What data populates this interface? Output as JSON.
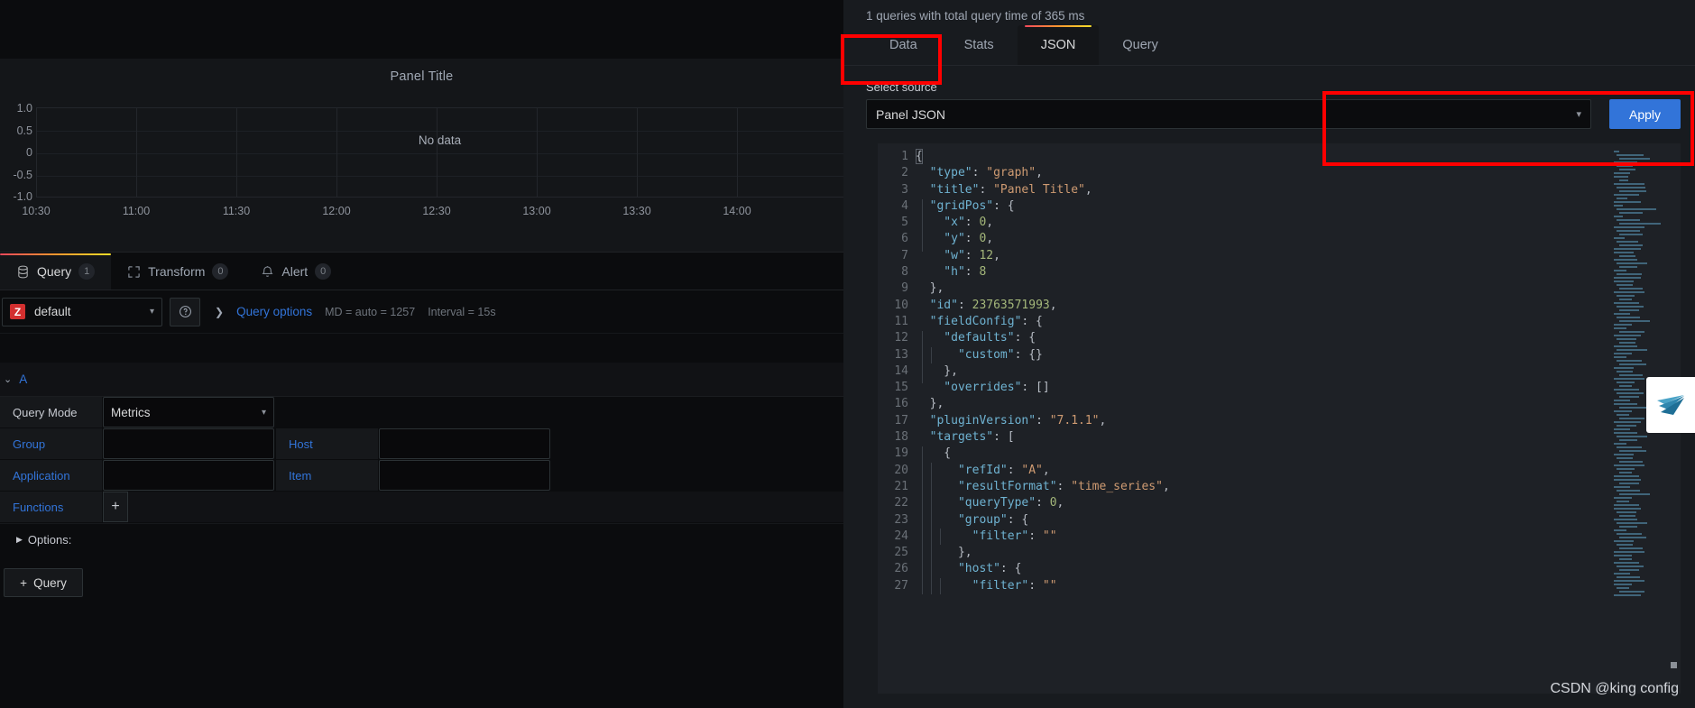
{
  "panel": {
    "title": "Panel Title",
    "no_data": "No data",
    "y_ticks": [
      "1.0",
      "0.5",
      "0",
      "-0.5",
      "-1.0"
    ],
    "x_ticks": [
      "10:30",
      "11:00",
      "11:30",
      "12:00",
      "12:30",
      "13:00",
      "13:30",
      "14:00"
    ]
  },
  "edit_tabs": [
    {
      "label": "Query",
      "count": "1",
      "icon": "database-icon",
      "active": true
    },
    {
      "label": "Transform",
      "count": "0",
      "icon": "transform-icon",
      "active": false
    },
    {
      "label": "Alert",
      "count": "0",
      "icon": "bell-icon",
      "active": false
    }
  ],
  "datasource": {
    "logo_text": "Z",
    "name": "default",
    "help_icon": "question-circle-icon",
    "query_options_label": "Query options",
    "max_data_points": "MD = auto = 1257",
    "interval": "Interval = 15s"
  },
  "query": {
    "ref_id": "A",
    "rows": [
      {
        "label": "Query Mode",
        "type": "select",
        "value": "Metrics",
        "label_style": "plain"
      },
      {
        "label": "Group",
        "type": "input",
        "value": "",
        "second_label": "Host",
        "second_value": ""
      },
      {
        "label": "Application",
        "type": "input",
        "value": "",
        "second_label": "Item",
        "second_value": ""
      },
      {
        "label": "Functions",
        "type": "plus",
        "value": "+"
      }
    ],
    "options_label": "Options:",
    "add_query_label": "Query",
    "add_query_icon": "plus-icon"
  },
  "inspect": {
    "subtitle": "1 queries with total query time of 365 ms",
    "tabs": [
      {
        "label": "Data",
        "active": false
      },
      {
        "label": "Stats",
        "active": false
      },
      {
        "label": "JSON",
        "active": true
      },
      {
        "label": "Query",
        "active": false
      }
    ],
    "select_source_label": "Select source",
    "selected_source": "Panel JSON",
    "apply_label": "Apply"
  },
  "code": {
    "lines": [
      {
        "n": 1,
        "tokens": [
          {
            "t": "{",
            "c": "p"
          }
        ]
      },
      {
        "n": 2,
        "tokens": [
          {
            "t": "  \"type\"",
            "c": "k"
          },
          {
            "t": ": ",
            "c": "p"
          },
          {
            "t": "\"graph\"",
            "c": "s"
          },
          {
            "t": ",",
            "c": "p"
          }
        ]
      },
      {
        "n": 3,
        "tokens": [
          {
            "t": "  \"title\"",
            "c": "k"
          },
          {
            "t": ": ",
            "c": "p"
          },
          {
            "t": "\"Panel Title\"",
            "c": "s"
          },
          {
            "t": ",",
            "c": "p"
          }
        ]
      },
      {
        "n": 4,
        "tokens": [
          {
            "t": "  \"gridPos\"",
            "c": "k"
          },
          {
            "t": ": {",
            "c": "p"
          }
        ]
      },
      {
        "n": 5,
        "tokens": [
          {
            "t": "    \"x\"",
            "c": "k"
          },
          {
            "t": ": ",
            "c": "p"
          },
          {
            "t": "0",
            "c": "n"
          },
          {
            "t": ",",
            "c": "p"
          }
        ]
      },
      {
        "n": 6,
        "tokens": [
          {
            "t": "    \"y\"",
            "c": "k"
          },
          {
            "t": ": ",
            "c": "p"
          },
          {
            "t": "0",
            "c": "n"
          },
          {
            "t": ",",
            "c": "p"
          }
        ]
      },
      {
        "n": 7,
        "tokens": [
          {
            "t": "    \"w\"",
            "c": "k"
          },
          {
            "t": ": ",
            "c": "p"
          },
          {
            "t": "12",
            "c": "n"
          },
          {
            "t": ",",
            "c": "p"
          }
        ]
      },
      {
        "n": 8,
        "tokens": [
          {
            "t": "    \"h\"",
            "c": "k"
          },
          {
            "t": ": ",
            "c": "p"
          },
          {
            "t": "8",
            "c": "n"
          }
        ]
      },
      {
        "n": 9,
        "tokens": [
          {
            "t": "  },",
            "c": "p"
          }
        ]
      },
      {
        "n": 10,
        "tokens": [
          {
            "t": "  \"id\"",
            "c": "k"
          },
          {
            "t": ": ",
            "c": "p"
          },
          {
            "t": "23763571993",
            "c": "n"
          },
          {
            "t": ",",
            "c": "p"
          }
        ]
      },
      {
        "n": 11,
        "tokens": [
          {
            "t": "  \"fieldConfig\"",
            "c": "k"
          },
          {
            "t": ": {",
            "c": "p"
          }
        ]
      },
      {
        "n": 12,
        "tokens": [
          {
            "t": "    \"defaults\"",
            "c": "k"
          },
          {
            "t": ": {",
            "c": "p"
          }
        ]
      },
      {
        "n": 13,
        "tokens": [
          {
            "t": "      \"custom\"",
            "c": "k"
          },
          {
            "t": ": {}",
            "c": "p"
          }
        ]
      },
      {
        "n": 14,
        "tokens": [
          {
            "t": "    },",
            "c": "p"
          }
        ]
      },
      {
        "n": 15,
        "tokens": [
          {
            "t": "    \"overrides\"",
            "c": "k"
          },
          {
            "t": ": []",
            "c": "p"
          }
        ]
      },
      {
        "n": 16,
        "tokens": [
          {
            "t": "  },",
            "c": "p"
          }
        ]
      },
      {
        "n": 17,
        "tokens": [
          {
            "t": "  \"pluginVersion\"",
            "c": "k"
          },
          {
            "t": ": ",
            "c": "p"
          },
          {
            "t": "\"7.1.1\"",
            "c": "s"
          },
          {
            "t": ",",
            "c": "p"
          }
        ]
      },
      {
        "n": 18,
        "tokens": [
          {
            "t": "  \"targets\"",
            "c": "k"
          },
          {
            "t": ": [",
            "c": "p"
          }
        ]
      },
      {
        "n": 19,
        "tokens": [
          {
            "t": "    {",
            "c": "p"
          }
        ]
      },
      {
        "n": 20,
        "tokens": [
          {
            "t": "      \"refId\"",
            "c": "k"
          },
          {
            "t": ": ",
            "c": "p"
          },
          {
            "t": "\"A\"",
            "c": "s"
          },
          {
            "t": ",",
            "c": "p"
          }
        ]
      },
      {
        "n": 21,
        "tokens": [
          {
            "t": "      \"resultFormat\"",
            "c": "k"
          },
          {
            "t": ": ",
            "c": "p"
          },
          {
            "t": "\"time_series\"",
            "c": "s"
          },
          {
            "t": ",",
            "c": "p"
          }
        ]
      },
      {
        "n": 22,
        "tokens": [
          {
            "t": "      \"queryType\"",
            "c": "k"
          },
          {
            "t": ": ",
            "c": "p"
          },
          {
            "t": "0",
            "c": "n"
          },
          {
            "t": ",",
            "c": "p"
          }
        ]
      },
      {
        "n": 23,
        "tokens": [
          {
            "t": "      \"group\"",
            "c": "k"
          },
          {
            "t": ": {",
            "c": "p"
          }
        ]
      },
      {
        "n": 24,
        "tokens": [
          {
            "t": "        \"filter\"",
            "c": "k"
          },
          {
            "t": ": ",
            "c": "p"
          },
          {
            "t": "\"\"",
            "c": "s"
          }
        ]
      },
      {
        "n": 25,
        "tokens": [
          {
            "t": "      },",
            "c": "p"
          }
        ]
      },
      {
        "n": 26,
        "tokens": [
          {
            "t": "      \"host\"",
            "c": "k"
          },
          {
            "t": ": {",
            "c": "p"
          }
        ]
      },
      {
        "n": 27,
        "tokens": [
          {
            "t": "        \"filter\"",
            "c": "k"
          },
          {
            "t": ": ",
            "c": "p"
          },
          {
            "t": "\"\"",
            "c": "s"
          }
        ]
      }
    ]
  },
  "watermark": "CSDN @king config",
  "colors": {
    "accent_blue": "#3274d9",
    "annotation_red": "#ff0000",
    "tab_gradient_start": "#f2495c",
    "tab_gradient_end": "#fade2a"
  }
}
